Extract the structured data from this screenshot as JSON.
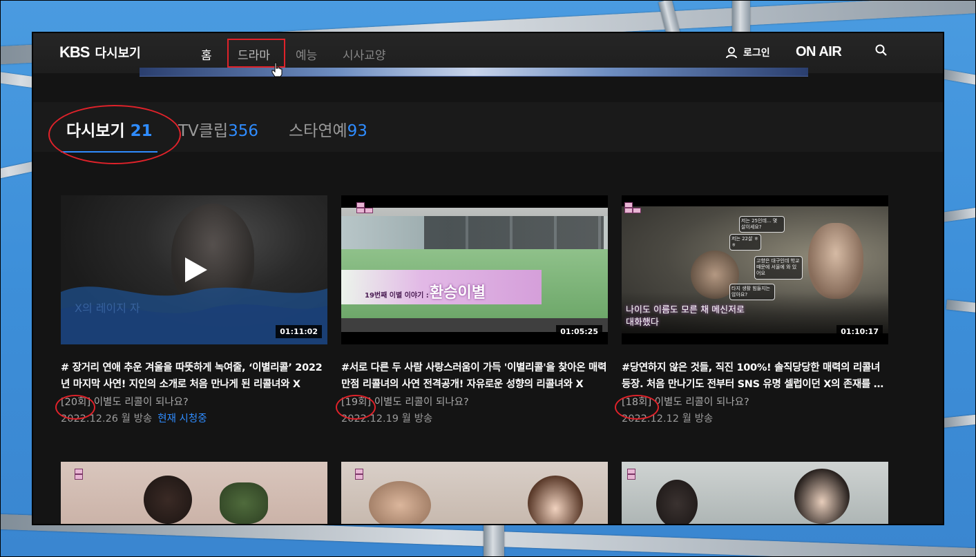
{
  "nav": {
    "logo_kbs": "KBS",
    "logo_sub": "다시보기",
    "menu": [
      "홈",
      "드라마",
      "예능",
      "시사교양"
    ],
    "login_label": "로그인",
    "onair_label": "ON AIR"
  },
  "tabs": [
    {
      "label": "다시보기",
      "count": "21",
      "active": true
    },
    {
      "label": "TV클립",
      "count": "356",
      "active": false
    },
    {
      "label": "스타연예",
      "count": "93",
      "active": false
    }
  ],
  "cards": [
    {
      "duration": "01:11:02",
      "title": "# 장거리 연애 추운 겨울을 따뜻하게 녹여줄, ‘이별리콜’ 2022년 마지막 사연! 지인의 소개로 처음 만나게 된 리콜녀와 X",
      "episode": "[20회]",
      "episode_title": " 이별도 리콜이 되나요?",
      "date": "2022.12.26 월 방송",
      "status": "현재 시청중",
      "thumb_text": "X의 레이지 자"
    },
    {
      "duration": "01:05:25",
      "title": "#서로 다른 두 사람 사랑스러움이 가득 '이별리콜'을 찾아온 매력만점 리콜녀의 사연 전격공개! 자유로운 성향의 리콜녀와 X",
      "episode": "[19회]",
      "episode_title": " 이별도 리콜이 되나요?",
      "date": "2022.12.19 월 방송",
      "status": "",
      "thumb_caption_small": "19번째 이별 이야기 :",
      "thumb_caption_big": "환승이별"
    },
    {
      "duration": "01:10:17",
      "title": "#당연하지 않은 것들, 직진 100%! 솔직당당한 매력의 리콜녀 등장. 처음 만나기도 전부터 SNS 유명 셀럽이던 X의 존재를 알고",
      "episode": "[18회]",
      "episode_title": " 이별도 리콜이 되나요?",
      "date": "2022.12.12 월 방송",
      "status": "",
      "thumb_caption": "나이도 이름도 모른 채 메신저로 대화했다",
      "bubbles": [
        "저는 25인데... 몇 살이세요?",
        "저는 22살 ㅎㅎ",
        "고향은 대구인데 학교 때문에 서울에 와 있어요",
        "타지 생활 힘들지는 않아요?"
      ]
    }
  ],
  "colors": {
    "accent": "#2f8cff",
    "annotation_red": "#e0222a",
    "background": "#141414"
  }
}
